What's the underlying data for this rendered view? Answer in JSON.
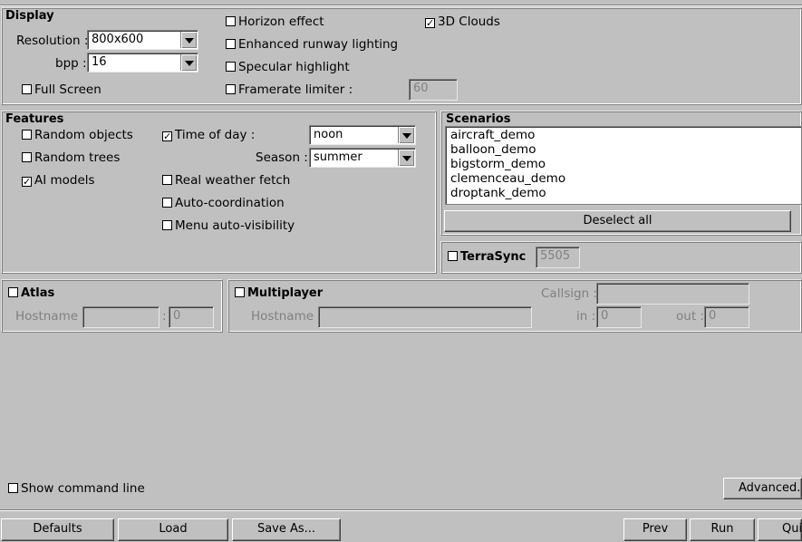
{
  "display": {
    "title": "Display",
    "resolution_label": "Resolution :",
    "resolution_value": "800x600",
    "bpp_label": "bpp :",
    "bpp_value": "16",
    "fullscreen_label": "Full Screen",
    "horizon_label": "Horizon effect",
    "runway_label": "Enhanced runway lighting",
    "specular_label": "Specular highlight",
    "framerate_label": "Framerate limiter :",
    "framerate_value": "60",
    "clouds_label": "3D Clouds"
  },
  "features": {
    "title": "Features",
    "random_objects_label": "Random objects",
    "random_trees_label": "Random trees",
    "ai_models_label": "AI models",
    "time_of_day_label": "Time of day :",
    "time_of_day_value": "noon",
    "season_label": "Season :",
    "season_value": "summer",
    "weather_label": "Real weather fetch",
    "autocoord_label": "Auto-coordination",
    "menu_autovis_label": "Menu auto-visibility"
  },
  "scenarios": {
    "title": "Scenarios",
    "items": [
      "aircraft_demo",
      "balloon_demo",
      "bigstorm_demo",
      "clemenceau_demo",
      "droptank_demo"
    ],
    "deselect_label": "Deselect all"
  },
  "terrasync": {
    "label": "TerraSync",
    "port_value": "5505"
  },
  "atlas": {
    "label": "Atlas",
    "hostname_label": "Hostname :",
    "hostname_value": "",
    "separator": ":",
    "port_value": "0"
  },
  "multiplayer": {
    "label": "Multiplayer",
    "callsign_label": "Callsign :",
    "callsign_value": "",
    "hostname_label": "Hostname :",
    "hostname_value": "",
    "in_label": "in :",
    "in_value": "0",
    "out_label": "out :",
    "out_value": "0"
  },
  "misc": {
    "show_cmdline_label": "Show command line",
    "advanced_label": "Advanced..."
  },
  "footer": {
    "defaults_label": "Defaults",
    "load_label": "Load",
    "saveas_label": "Save As...",
    "prev_label": "Prev",
    "run_label": "Run",
    "quit_label": "Quit"
  }
}
